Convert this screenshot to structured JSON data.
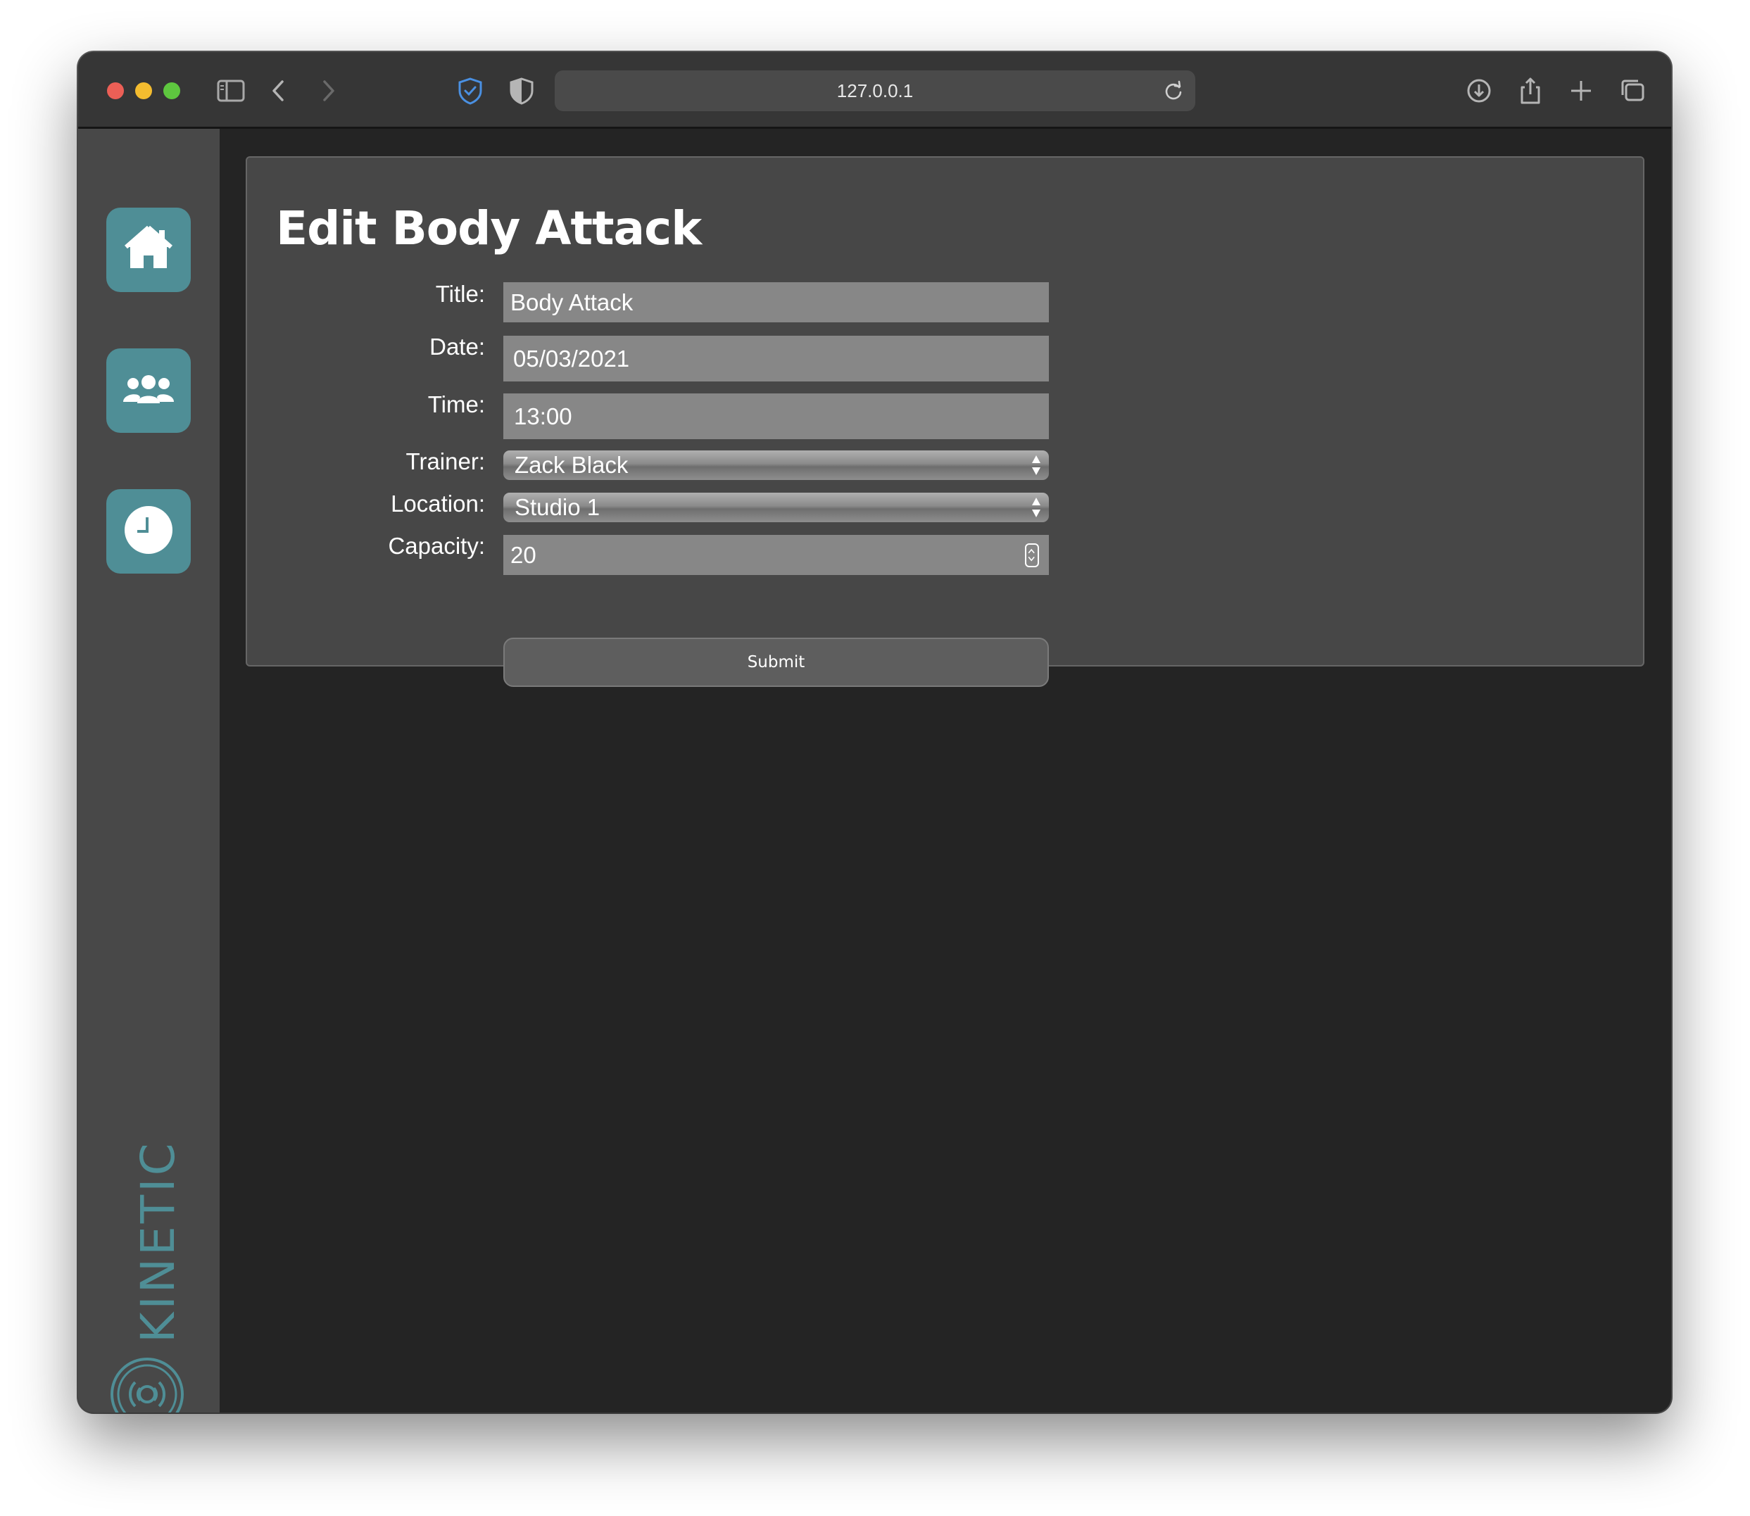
{
  "browser": {
    "url": "127.0.0.1"
  },
  "sidebar": {
    "items": [
      {
        "name": "home",
        "icon": "home-icon"
      },
      {
        "name": "members",
        "icon": "users-icon"
      },
      {
        "name": "schedule",
        "icon": "clock-icon"
      }
    ],
    "brand": "KINETIC",
    "accent_color": "#4f8e96"
  },
  "form": {
    "heading": "Edit Body Attack",
    "fields": {
      "title": {
        "label": "Title:",
        "value": "Body Attack"
      },
      "date": {
        "label": "Date:",
        "value": "05/03/2021"
      },
      "time": {
        "label": "Time:",
        "value": "13:00"
      },
      "trainer": {
        "label": "Trainer:",
        "value": "Zack Black"
      },
      "location": {
        "label": "Location:",
        "value": "Studio 1"
      },
      "capacity": {
        "label": "Capacity:",
        "value": "20"
      }
    },
    "submit_label": "Submit"
  }
}
